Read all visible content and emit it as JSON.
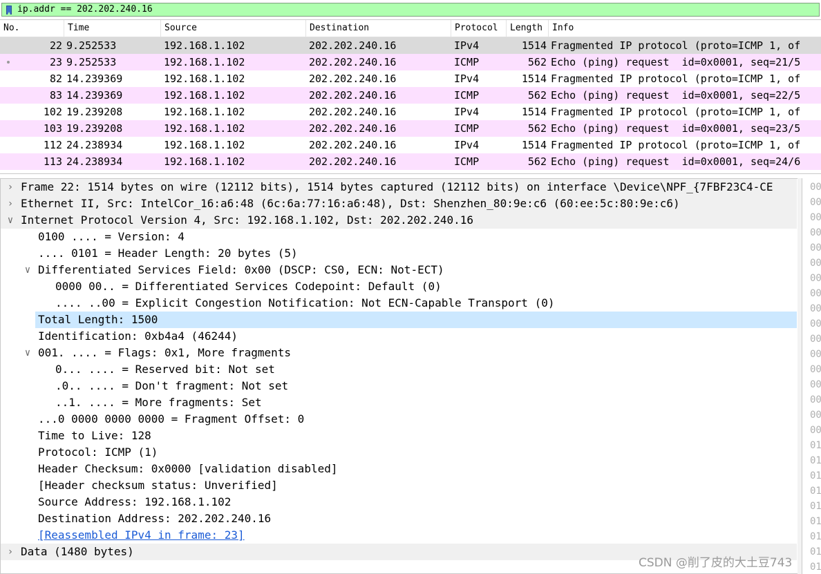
{
  "colors": {
    "filter_bg": "#afffaf",
    "tcp_row_bg": "#ffffff",
    "icmp_row_bg": "#fce0ff",
    "selected_row_bg": "#dadada",
    "selected_detail_bg": "#cce8ff",
    "link": "#1a5bd6"
  },
  "filter": {
    "value": "ip.addr == 202.202.240.16",
    "icon": "bookmark-icon"
  },
  "columns": [
    "No.",
    "Time",
    "Source",
    "Destination",
    "Protocol",
    "Length",
    "Info"
  ],
  "packets": [
    {
      "no": "22",
      "time": "9.252533",
      "source": "192.168.1.102",
      "destination": "202.202.240.16",
      "protocol": "IPv4",
      "length": "1514",
      "info": "Fragmented IP protocol (proto=ICMP 1, of",
      "style": "selected"
    },
    {
      "no": "23",
      "time": "9.252533",
      "source": "192.168.1.102",
      "destination": "202.202.240.16",
      "protocol": "ICMP",
      "length": "562",
      "info": "Echo (ping) request  id=0x0001, seq=21/5",
      "style": "icmp"
    },
    {
      "no": "82",
      "time": "14.239369",
      "source": "192.168.1.102",
      "destination": "202.202.240.16",
      "protocol": "IPv4",
      "length": "1514",
      "info": "Fragmented IP protocol (proto=ICMP 1, of",
      "style": "plain"
    },
    {
      "no": "83",
      "time": "14.239369",
      "source": "192.168.1.102",
      "destination": "202.202.240.16",
      "protocol": "ICMP",
      "length": "562",
      "info": "Echo (ping) request  id=0x0001, seq=22/5",
      "style": "icmp"
    },
    {
      "no": "102",
      "time": "19.239208",
      "source": "192.168.1.102",
      "destination": "202.202.240.16",
      "protocol": "IPv4",
      "length": "1514",
      "info": "Fragmented IP protocol (proto=ICMP 1, of",
      "style": "plain"
    },
    {
      "no": "103",
      "time": "19.239208",
      "source": "192.168.1.102",
      "destination": "202.202.240.16",
      "protocol": "ICMP",
      "length": "562",
      "info": "Echo (ping) request  id=0x0001, seq=23/5",
      "style": "icmp"
    },
    {
      "no": "112",
      "time": "24.238934",
      "source": "192.168.1.102",
      "destination": "202.202.240.16",
      "protocol": "IPv4",
      "length": "1514",
      "info": "Fragmented IP protocol (proto=ICMP 1, of",
      "style": "plain"
    },
    {
      "no": "113",
      "time": "24.238934",
      "source": "192.168.1.102",
      "destination": "202.202.240.16",
      "protocol": "ICMP",
      "length": "562",
      "info": "Echo (ping) request  id=0x0001, seq=24/6",
      "style": "icmp"
    }
  ],
  "details": [
    {
      "level": 0,
      "arrow": "collapsed",
      "text": "Frame 22: 1514 bytes on wire (12112 bits), 1514 bytes captured (12112 bits) on interface \\Device\\NPF_{7FBF23C4-CE",
      "style": "section"
    },
    {
      "level": 0,
      "arrow": "collapsed",
      "text": "Ethernet II, Src: IntelCor_16:a6:48 (6c:6a:77:16:a6:48), Dst: Shenzhen_80:9e:c6 (60:ee:5c:80:9e:c6)",
      "style": "section"
    },
    {
      "level": 0,
      "arrow": "expanded",
      "text": "Internet Protocol Version 4, Src: 192.168.1.102, Dst: 202.202.240.16",
      "style": "section"
    },
    {
      "level": 1,
      "arrow": "",
      "text": "0100 .... = Version: 4",
      "style": ""
    },
    {
      "level": 1,
      "arrow": "",
      "text": ".... 0101 = Header Length: 20 bytes (5)",
      "style": ""
    },
    {
      "level": 1,
      "arrow": "expanded",
      "text": "Differentiated Services Field: 0x00 (DSCP: CS0, ECN: Not-ECT)",
      "style": ""
    },
    {
      "level": 2,
      "arrow": "",
      "text": "0000 00.. = Differentiated Services Codepoint: Default (0)",
      "style": ""
    },
    {
      "level": 2,
      "arrow": "",
      "text": ".... ..00 = Explicit Congestion Notification: Not ECN-Capable Transport (0)",
      "style": ""
    },
    {
      "level": 1,
      "arrow": "",
      "text": "Total Length: 1500",
      "style": "selected"
    },
    {
      "level": 1,
      "arrow": "",
      "text": "Identification: 0xb4a4 (46244)",
      "style": ""
    },
    {
      "level": 1,
      "arrow": "expanded",
      "text": "001. .... = Flags: 0x1, More fragments",
      "style": ""
    },
    {
      "level": 2,
      "arrow": "",
      "text": "0... .... = Reserved bit: Not set",
      "style": ""
    },
    {
      "level": 2,
      "arrow": "",
      "text": ".0.. .... = Don't fragment: Not set",
      "style": ""
    },
    {
      "level": 2,
      "arrow": "",
      "text": "..1. .... = More fragments: Set",
      "style": ""
    },
    {
      "level": 1,
      "arrow": "",
      "text": "...0 0000 0000 0000 = Fragment Offset: 0",
      "style": ""
    },
    {
      "level": 1,
      "arrow": "",
      "text": "Time to Live: 128",
      "style": ""
    },
    {
      "level": 1,
      "arrow": "",
      "text": "Protocol: ICMP (1)",
      "style": ""
    },
    {
      "level": 1,
      "arrow": "",
      "text": "Header Checksum: 0x0000 [validation disabled]",
      "style": ""
    },
    {
      "level": 1,
      "arrow": "",
      "text": "[Header checksum status: Unverified]",
      "style": ""
    },
    {
      "level": 1,
      "arrow": "",
      "text": "Source Address: 192.168.1.102",
      "style": ""
    },
    {
      "level": 1,
      "arrow": "",
      "text": "Destination Address: 202.202.240.16",
      "style": ""
    },
    {
      "level": 1,
      "arrow": "",
      "text": "[Reassembled IPv4 in frame: 23]",
      "style": "link"
    },
    {
      "level": 0,
      "arrow": "collapsed",
      "text": "Data (1480 bytes)",
      "style": "section"
    }
  ],
  "bytes_offsets": [
    "00",
    "00",
    "00",
    "00",
    "00",
    "00",
    "00",
    "00",
    "00",
    "00",
    "00",
    "00",
    "00",
    "00",
    "00",
    "00",
    "00",
    "01",
    "01",
    "01",
    "01",
    "01",
    "01",
    "01",
    "01",
    "01"
  ],
  "watermark": "CSDN @削了皮的大土豆743"
}
